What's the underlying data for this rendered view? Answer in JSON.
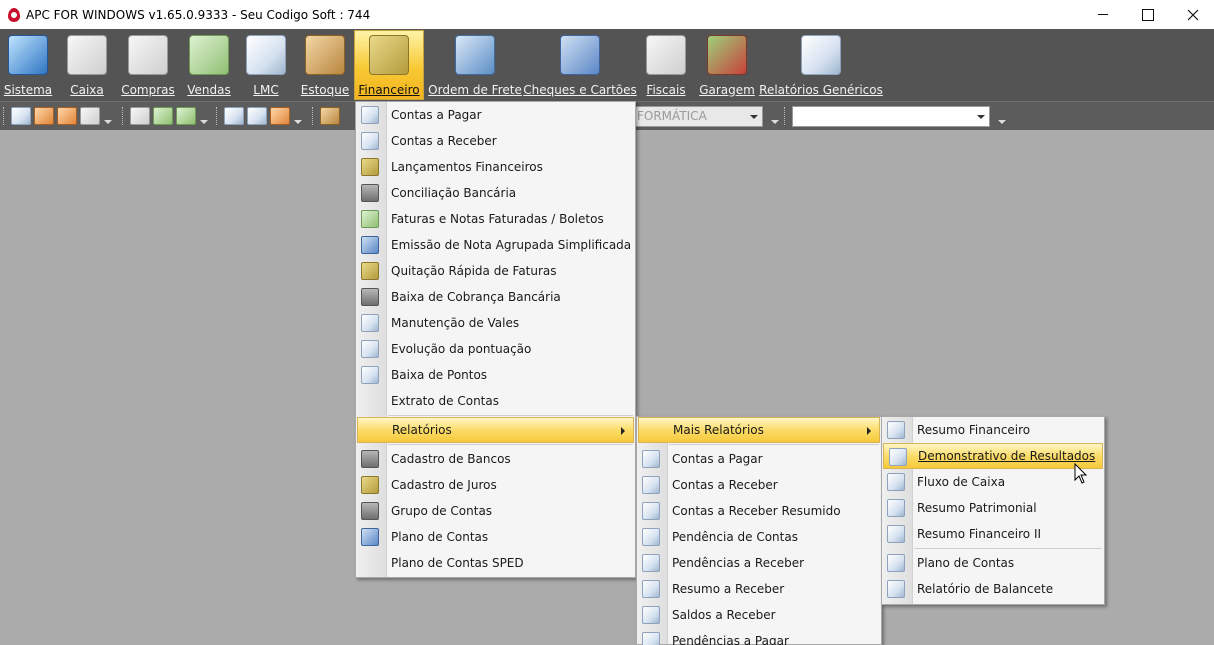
{
  "window": {
    "title": "APC FOR WINDOWS v1.65.0.9333 - Seu Codigo Soft : 744"
  },
  "toolbar": {
    "items": [
      {
        "label": "Sistema",
        "icon": "monitor-icon"
      },
      {
        "label": "Caixa",
        "icon": "cash-register-icon"
      },
      {
        "label": "Compras",
        "icon": "calculator-icon"
      },
      {
        "label": "Vendas",
        "icon": "spreadsheet-icon"
      },
      {
        "label": "LMC",
        "icon": "document-icon"
      },
      {
        "label": "Estoque",
        "icon": "box-icon"
      },
      {
        "label": "Financeiro",
        "icon": "money-icon",
        "active": true
      },
      {
        "label": "Ordem de Frete",
        "icon": "truck-icon"
      },
      {
        "label": "Cheques e Cartões",
        "icon": "cards-icon"
      },
      {
        "label": "Fiscais",
        "icon": "fiscal-icon"
      },
      {
        "label": "Garagem",
        "icon": "cars-icon"
      },
      {
        "label": "Relatórios Genéricos",
        "icon": "report-icon"
      }
    ]
  },
  "toolbar2": {
    "combo1_value": "FORMÁTICA",
    "combo2_value": ""
  },
  "menu_financeiro": {
    "items": [
      {
        "label": "Contas a Pagar"
      },
      {
        "label": "Contas a Receber"
      },
      {
        "label": "Lançamentos Financeiros"
      },
      {
        "label": "Conciliação Bancária"
      },
      {
        "label": "Faturas e Notas Faturadas / Boletos"
      },
      {
        "label": "Emissão de Nota Agrupada Simplificada"
      },
      {
        "label": "Quitação Rápida de Faturas"
      },
      {
        "label": "Baixa de Cobrança Bancária"
      },
      {
        "label": "Manutenção de Vales"
      },
      {
        "label": "Evolução da pontuação"
      },
      {
        "label": "Baixa de Pontos"
      },
      {
        "label": "Extrato de Contas"
      },
      {
        "label": "Relatórios"
      },
      {
        "label": "Cadastro de Bancos"
      },
      {
        "label": "Cadastro de Juros"
      },
      {
        "label": "Grupo de Contas"
      },
      {
        "label": "Plano de Contas"
      },
      {
        "label": "Plano de Contas SPED"
      }
    ]
  },
  "menu_relatorios": {
    "items": [
      {
        "label": "Mais Relatórios"
      },
      {
        "label": "Contas a Pagar"
      },
      {
        "label": "Contas a Receber"
      },
      {
        "label": "Contas a Receber Resumido"
      },
      {
        "label": "Pendência de Contas"
      },
      {
        "label": "Pendências a Receber"
      },
      {
        "label": "Resumo a Receber"
      },
      {
        "label": "Saldos a Receber"
      },
      {
        "label": "Pendências a Pagar"
      }
    ]
  },
  "menu_mais_relatorios": {
    "items": [
      {
        "label": "Resumo Financeiro"
      },
      {
        "label": "Demonstrativo de Resultados"
      },
      {
        "label": "Fluxo de Caixa"
      },
      {
        "label": "Resumo Patrimonial"
      },
      {
        "label": "Resumo Financeiro II"
      },
      {
        "label": "Plano de Contas"
      },
      {
        "label": "Relatório de Balancete"
      }
    ]
  },
  "colors": {
    "toolbar_bg": "#545454",
    "desktop_bg": "#ababab",
    "highlight": "#fbdc6a",
    "active_tab": "#f7c933"
  }
}
